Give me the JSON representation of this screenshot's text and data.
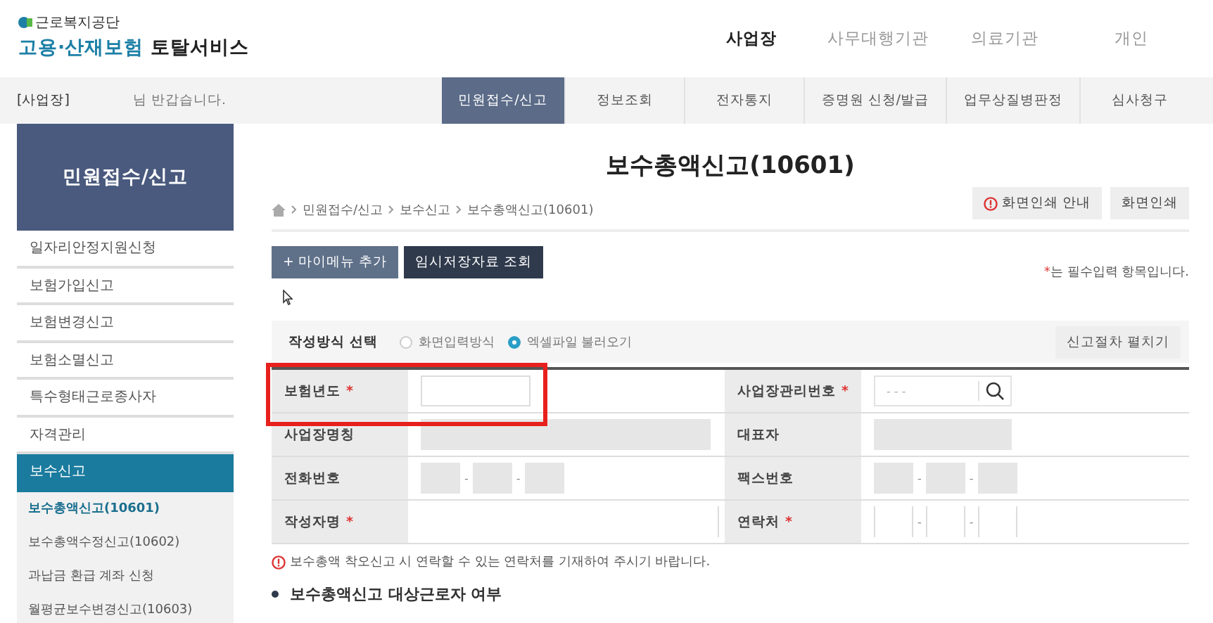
{
  "logo": {
    "org": "근로복지공단",
    "title_1": "고용·산재보험",
    "title_2": "토탈서비스"
  },
  "top_nav": [
    {
      "label": "사업장",
      "selected": true
    },
    {
      "label": "사무대행기관",
      "selected": false
    },
    {
      "label": "의료기관",
      "selected": false
    },
    {
      "label": "개인",
      "selected": false
    }
  ],
  "user_bar": {
    "user": "[사업장]",
    "greeting": "님 반갑습니다."
  },
  "main_tabs": [
    {
      "label": "민원접수/신고",
      "selected": true
    },
    {
      "label": "정보조회",
      "selected": false
    },
    {
      "label": "전자통지",
      "selected": false
    },
    {
      "label": "증명원 신청/발급",
      "selected": false
    },
    {
      "label": "업무상질병판정",
      "selected": false
    },
    {
      "label": "심사청구",
      "selected": false
    }
  ],
  "sidebar": {
    "title": "민원접수/신고",
    "items": [
      {
        "label": "일자리안정지원신청",
        "selected": false
      },
      {
        "label": "보험가입신고",
        "selected": false
      },
      {
        "label": "보험변경신고",
        "selected": false
      },
      {
        "label": "보험소멸신고",
        "selected": false
      },
      {
        "label": "특수형태근로종사자",
        "selected": false
      },
      {
        "label": "자격관리",
        "selected": false
      },
      {
        "label": "보수신고",
        "selected": true,
        "children": [
          {
            "label": "보수총액신고(10601)",
            "selected": true
          },
          {
            "label": "보수총액수정신고(10602)",
            "selected": false
          },
          {
            "label": "과납금 환급 계좌 신청",
            "selected": false
          },
          {
            "label": "월평균보수변경신고(10603)",
            "selected": false
          }
        ]
      }
    ]
  },
  "page": {
    "title": "보수총액신고(10601)",
    "breadcrumb": [
      "민원접수/신고",
      "보수신고",
      "보수총액신고(10601)"
    ],
    "print_buttons": [
      {
        "label": "화면인쇄 안내",
        "kind": "alert"
      },
      {
        "label": "화면인쇄",
        "kind": "plain"
      }
    ],
    "action_buttons": [
      {
        "label": "+ 마이메뉴 추가",
        "kind": "light"
      },
      {
        "label": "임시저장자료 조회",
        "kind": "dark"
      }
    ],
    "required_mark": "*",
    "required_note": "는 필수입력 항목입니다.",
    "method": {
      "label": "작성방식 선택",
      "options": [
        {
          "label": "화면입력방식",
          "selected": false
        },
        {
          "label": "엑셀파일 불러오기",
          "selected": true
        }
      ],
      "toggle": "신고절차 펼치기"
    },
    "form": [
      {
        "label": "보험년도",
        "required": true,
        "kind": "input",
        "highlighted": true
      },
      {
        "label": "사업장관리번호",
        "required": true,
        "kind": "search",
        "placeholder": "- -  -"
      },
      {
        "label": "사업장명칭",
        "required": false,
        "kind": "readonly"
      },
      {
        "label": "대표자",
        "required": false,
        "kind": "readonly"
      },
      {
        "label": "전화번호",
        "required": false,
        "kind": "phone",
        "disabled": true,
        "separators": [
          "-",
          "-"
        ]
      },
      {
        "label": "팩스번호",
        "required": false,
        "kind": "phone",
        "disabled": true,
        "separators": [
          "-",
          "-"
        ]
      },
      {
        "label": "작성자명",
        "required": true,
        "kind": "wide"
      },
      {
        "label": "연락처",
        "required": true,
        "kind": "phone",
        "disabled": false,
        "separators": [
          "-",
          "-"
        ]
      }
    ],
    "note": "보수총액 착오신고 시 연락할 수 있는 연락처를 기재하여 주시기 바랍니다.",
    "section_heading": "보수총액신고 대상근로자 여부"
  }
}
